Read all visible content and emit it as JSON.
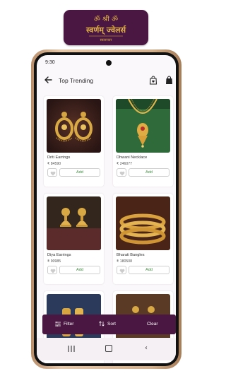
{
  "logo": {
    "symbols": "ॐ श्री ॐ",
    "brand_text": "स्वर्णम् ज्वेलर्स",
    "sub_text": "सातारकर",
    "color": "#4a1642",
    "gold": "#e0b24a"
  },
  "status_bar": {
    "time": "9:30"
  },
  "app_bar": {
    "title": "Top Trending",
    "back_icon": "arrow-left-icon",
    "wishlist_icon": "heart-bag-icon",
    "cart_icon": "shopping-bag-icon"
  },
  "products": [
    {
      "name": "Driti Earrings",
      "price": "₹ 84590",
      "add_label": "Add"
    },
    {
      "name": "Dhwani Necklace",
      "price": "₹ 246077",
      "add_label": "Add"
    },
    {
      "name": "Diya Earrings",
      "price": "₹ 90985",
      "add_label": "Add"
    },
    {
      "name": "Bharati Bangles",
      "price": "₹ 180508",
      "add_label": "Add"
    },
    {
      "name": "",
      "price": "",
      "add_label": ""
    },
    {
      "name": "",
      "price": "",
      "add_label": ""
    }
  ],
  "bottom_bar": {
    "filter_label": "Filter",
    "sort_label": "Sort",
    "clear_label": "Clear"
  },
  "colors": {
    "brand": "#4a1642",
    "add_text": "#3f8f3f",
    "gold": "#d9a640"
  }
}
